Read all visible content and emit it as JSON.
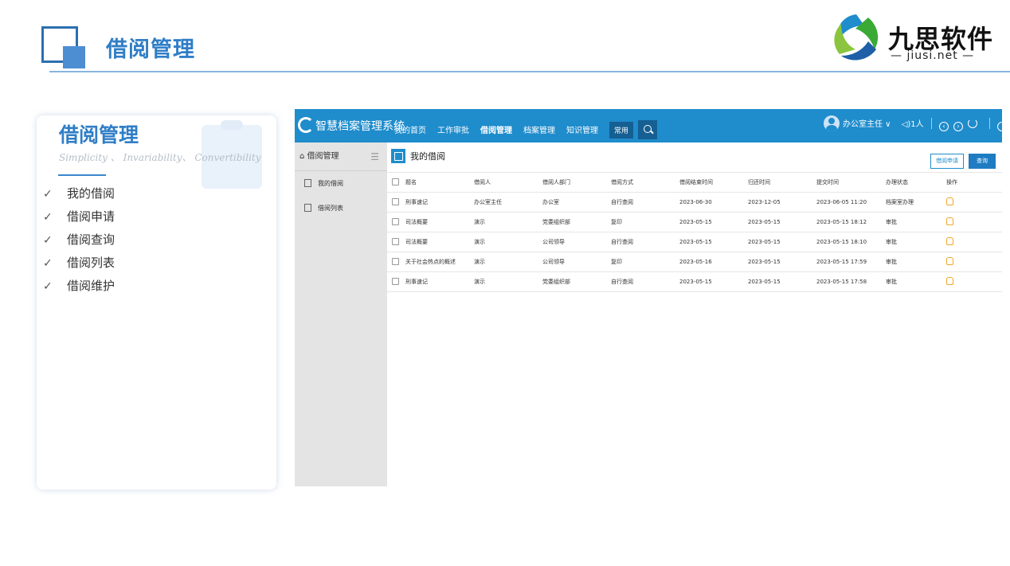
{
  "header": {
    "title": "借阅管理"
  },
  "logo": {
    "name": "九思软件",
    "sub": "— jiusi.net —"
  },
  "card": {
    "title": "借阅管理",
    "subtitle": "Simplicity 、 Invariability、 Convertibility",
    "items": [
      {
        "label": "我的借阅"
      },
      {
        "label": "借阅申请"
      },
      {
        "label": "借阅查询"
      },
      {
        "label": "借阅列表"
      },
      {
        "label": "借阅维护"
      }
    ]
  },
  "app": {
    "brand": "智慧档案管理系统",
    "nav": [
      "我的首页",
      "工作审批",
      "借阅管理",
      "档案管理",
      "知识管理"
    ],
    "nav_pill": "常用",
    "user": "办公室主任 ∨",
    "online": "1人",
    "sidebar": {
      "title": "借阅管理",
      "items": [
        {
          "label": "我的借阅"
        },
        {
          "label": "借阅列表"
        }
      ]
    },
    "content": {
      "title": "我的借阅",
      "apply_button": "借阅申请",
      "query_button": "查询",
      "columns": [
        "题名",
        "借阅人",
        "借阅人部门",
        "借阅方式",
        "借阅结束时间",
        "归还时间",
        "提交时间",
        "办理状态",
        "操作"
      ],
      "rows": [
        [
          "刑事速记",
          "办公室主任",
          "办公室",
          "自行查阅",
          "2023-06-30",
          "2023-12-05",
          "2023-06-05 11:20",
          "档案室办理"
        ],
        [
          "司法概要",
          "演示",
          "党委组织部",
          "复印",
          "2023-05-15",
          "2023-05-15",
          "2023-05-15 18:12",
          "审批"
        ],
        [
          "司法概要",
          "演示",
          "公司领导",
          "自行查阅",
          "2023-05-15",
          "2023-05-15",
          "2023-05-15 18:10",
          "审批"
        ],
        [
          "关于社会热点的概述",
          "演示",
          "公司领导",
          "复印",
          "2023-05-16",
          "2023-05-15",
          "2023-05-15 17:59",
          "审批"
        ],
        [
          "刑事速记",
          "演示",
          "党委组织部",
          "自行查阅",
          "2023-05-15",
          "2023-05-15",
          "2023-05-15 17:58",
          "审批"
        ]
      ]
    }
  }
}
